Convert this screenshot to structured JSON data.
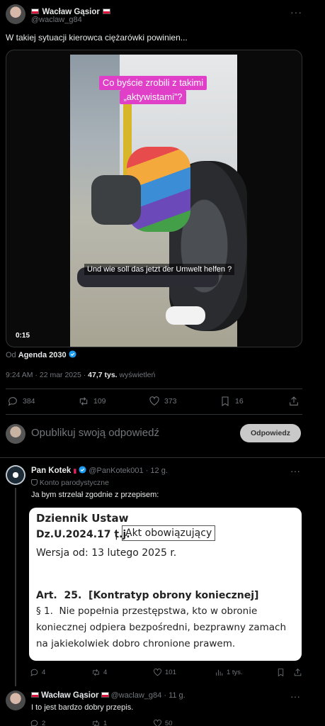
{
  "tweet": {
    "author_name": "Wacław Gąsior",
    "author_handle": "@waclaw_g84",
    "text": "W takiej sytuacji kierowca ciężarówki powinien...",
    "video": {
      "caption_top_line1": "Co byście zrobili z takimi",
      "caption_top_line2": "„aktywistami”?",
      "subtitle": "Und wie soll das jetzt der Umwelt helfen ?",
      "duration": "0:15"
    },
    "source_prefix": "Od",
    "source_name": "Agenda 2030",
    "timestamp": "9:24 AM · 22 mar 2025 ·",
    "views_count": "47,7 tys.",
    "views_label": "wyświetleń",
    "stats": {
      "replies": "384",
      "retweets": "109",
      "likes": "373",
      "bookmarks": "16"
    }
  },
  "composer": {
    "placeholder": "Opublikuj swoją odpowiedź",
    "reply_button": "Odpowiedz"
  },
  "reply1": {
    "author_name": "Pan Kotek",
    "author_handle": "@PanKotek001",
    "time": "· 12 g.",
    "label": "Konto parodystyczne",
    "text": "Ja bym strzelał zgodnie z przepisem:",
    "doc": {
      "title": "Dziennik Ustaw",
      "ref": "Dz.U.2024.17 t.j.",
      "separator": "|",
      "status": "Akt obowiązujący",
      "version": "Wersja od: 13 lutego 2025 r.",
      "article_heading": "Art.  25.  [Kontratyp obrony koniecznej]",
      "para_line1": "§ 1.  Nie popełnia przestępstwa, kto w obronie",
      "para_line2": "koniecznej odpiera bezpośredni, bezprawny zamach",
      "para_line3": "na jakiekolwiek dobro chronione prawem."
    },
    "stats": {
      "replies": "4",
      "retweets": "4",
      "likes": "101",
      "views": "1 tys."
    }
  },
  "reply2": {
    "author_name": "Wacław Gąsior",
    "author_handle": "@waclaw_g84",
    "time": "· 11 g.",
    "text": "I to jest bardzo dobry przepis.",
    "stats": {
      "replies": "2",
      "retweets": "1",
      "likes": "50"
    }
  },
  "colors": {
    "verified": "#1d9bf0",
    "caption_bg": "#e040c8",
    "button_bg": "#c9c9c9",
    "background": "#000000"
  },
  "icons": [
    "more-icon",
    "reply-icon",
    "retweet-icon",
    "like-icon",
    "bookmark-icon",
    "share-icon",
    "views-icon",
    "verified-icon",
    "flag-icon",
    "lipstick-icon",
    "parody-icon"
  ]
}
